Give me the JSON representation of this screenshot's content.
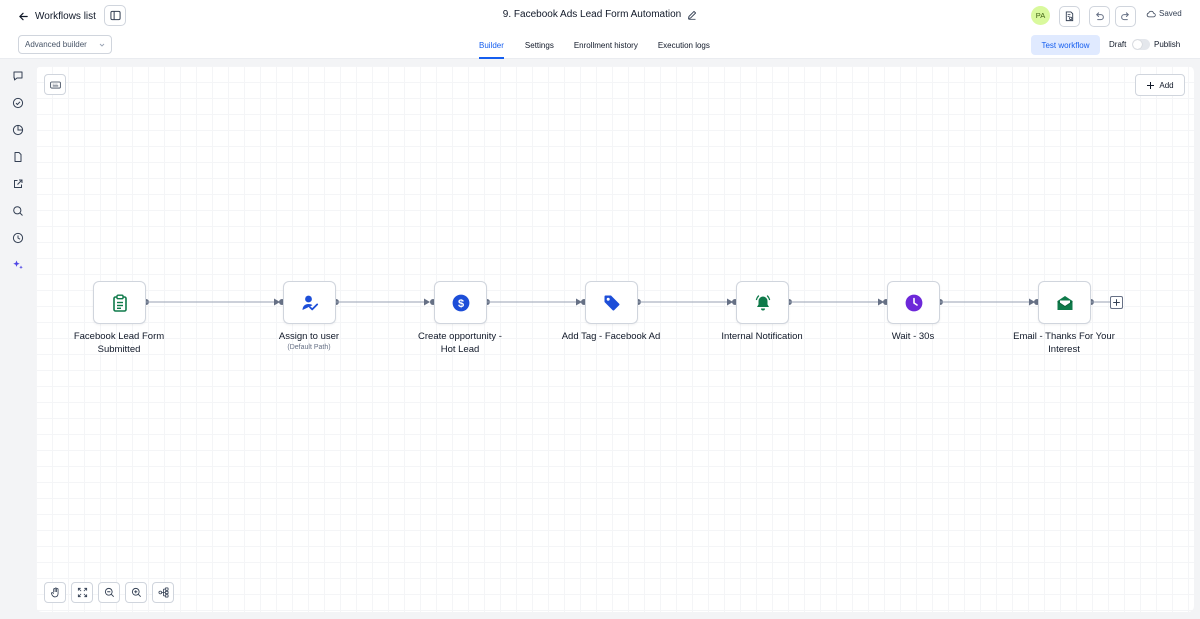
{
  "header": {
    "back_label": "Workflows list",
    "title": "9. Facebook Ads Lead Form Automation",
    "avatar_initials": "PA",
    "saved_label": "Saved"
  },
  "subheader": {
    "builder_mode": "Advanced builder",
    "tabs": [
      {
        "label": "Builder",
        "active": true
      },
      {
        "label": "Settings",
        "active": false
      },
      {
        "label": "Enrollment history",
        "active": false
      },
      {
        "label": "Execution logs",
        "active": false
      }
    ],
    "test_workflow_label": "Test workflow",
    "draft_label": "Draft",
    "publish_label": "Publish"
  },
  "canvas": {
    "add_label": "Add",
    "nodes": [
      {
        "label_line1": "Facebook Lead Form",
        "label_line2": "Submitted",
        "sublabel": "",
        "icon": "clipboard-icon",
        "color": "#0f7a4a"
      },
      {
        "label_line1": "Assign to user",
        "label_line2": "",
        "sublabel": "(Default Path)",
        "icon": "user-assign-icon",
        "color": "#1d4ed8"
      },
      {
        "label_line1": "Create opportunity -",
        "label_line2": "Hot Lead",
        "sublabel": "",
        "icon": "dollar-icon",
        "color": "#1d4ed8"
      },
      {
        "label_line1": "Add Tag - Facebook Ad",
        "label_line2": "",
        "sublabel": "",
        "icon": "tag-icon",
        "color": "#1d4ed8"
      },
      {
        "label_line1": "Internal Notification",
        "label_line2": "",
        "sublabel": "",
        "icon": "bell-icon",
        "color": "#0f7a4a"
      },
      {
        "label_line1": "Wait - 30s",
        "label_line2": "",
        "sublabel": "",
        "icon": "clock-icon",
        "color": "#6d28d9"
      },
      {
        "label_line1": "Email - Thanks For Your",
        "label_line2": "Interest",
        "sublabel": "",
        "icon": "email-icon",
        "color": "#0f7a4a"
      }
    ]
  },
  "colors": {
    "accent": "#155eef",
    "tab_active_bg": "#e0eaff",
    "avatar_bg": "#d9f99d"
  }
}
